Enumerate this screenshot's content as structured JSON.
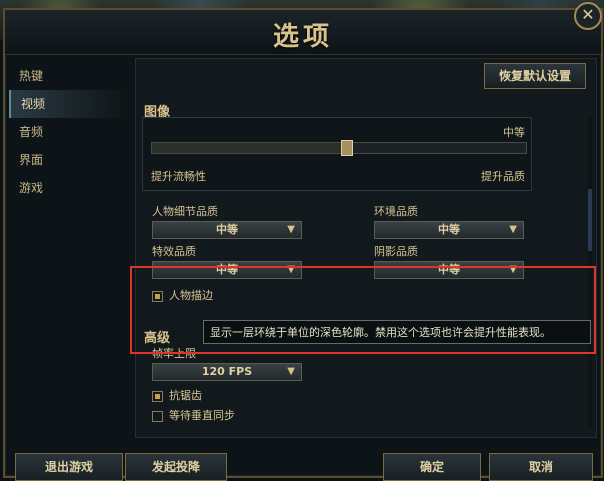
{
  "window": {
    "title": "选项",
    "close_icon": "✕"
  },
  "sidebar": {
    "items": [
      {
        "label": "热键"
      },
      {
        "label": "视频"
      },
      {
        "label": "音频"
      },
      {
        "label": "界面"
      },
      {
        "label": "游戏"
      }
    ]
  },
  "header": {
    "reset_label": "恢复默认设置"
  },
  "graphics": {
    "section_title": "图像",
    "quality_value": "中等",
    "slider_level_percent": 52,
    "slider_left_label": "提升流畅性",
    "slider_right_label": "提升品质",
    "character_quality": {
      "label": "人物细节品质",
      "value": "中等"
    },
    "environment_quality": {
      "label": "环境品质",
      "value": "中等"
    },
    "effects_quality": {
      "label": "特效品质",
      "value": "中等"
    },
    "shadow_quality": {
      "label": "阴影品质",
      "value": "中等"
    },
    "character_outline": {
      "label": "人物描边",
      "checked": true
    }
  },
  "advanced": {
    "section_title": "高级",
    "frame_rate_label": "帧率上限",
    "frame_rate_value": "120 FPS",
    "anti_aliasing": {
      "label": "抗锯齿",
      "checked": true
    },
    "vsync": {
      "label": "等待垂直同步",
      "checked": false
    }
  },
  "tooltip": {
    "text": "显示一层环绕于单位的深色轮廓。禁用这个选项也许会提升性能表现。"
  },
  "footer": {
    "exit_label": "退出游戏",
    "surrender_label": "发起投降",
    "ok_label": "确定",
    "cancel_label": "取消"
  },
  "colors": {
    "highlight": "#e2332b",
    "accent_gold": "#c9a04a"
  }
}
